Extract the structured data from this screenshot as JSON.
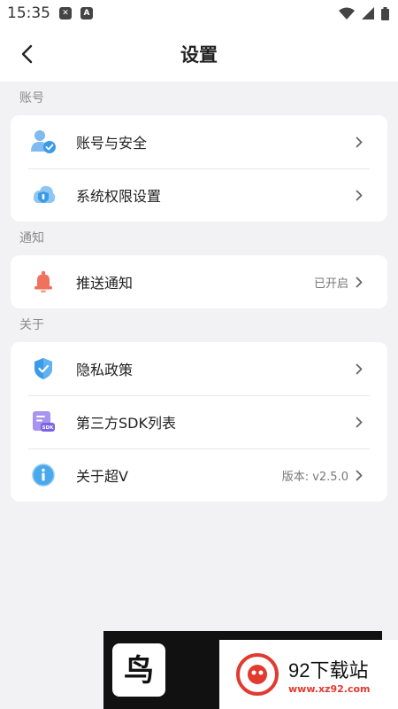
{
  "status_bar": {
    "time": "15:35"
  },
  "header": {
    "title": "设置"
  },
  "sections": [
    {
      "label": "账号",
      "items": [
        {
          "label": "账号与安全",
          "value": "",
          "icon": "user-shield-icon"
        },
        {
          "label": "系统权限设置",
          "value": "",
          "icon": "permission-shield-icon"
        }
      ]
    },
    {
      "label": "通知",
      "items": [
        {
          "label": "推送通知",
          "value": "已开启",
          "icon": "bell-icon"
        }
      ]
    },
    {
      "label": "关于",
      "items": [
        {
          "label": "隐私政策",
          "value": "",
          "icon": "privacy-shield-icon"
        },
        {
          "label": "第三方SDK列表",
          "value": "",
          "icon": "sdk-list-icon"
        },
        {
          "label": "关于超V",
          "value": "版本: v2.5.0",
          "icon": "info-icon"
        }
      ]
    }
  ],
  "watermark": {
    "brand": "92下载站",
    "url": "www.xz92.com"
  },
  "colors": {
    "accent_blue": "#3a9be8",
    "bell_red": "#f0715e",
    "sdk_purple": "#8a74e8"
  }
}
